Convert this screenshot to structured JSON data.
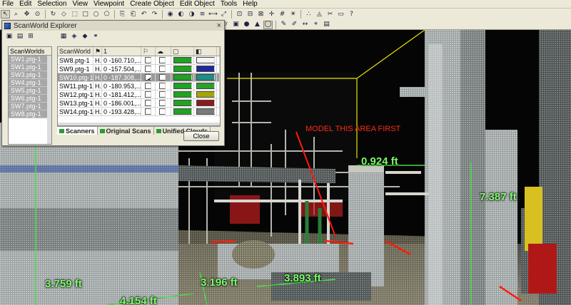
{
  "menu": [
    "File",
    "Edit",
    "Selection",
    "View",
    "Viewpoint",
    "Create Object",
    "Edit Object",
    "Tools",
    "Help"
  ],
  "toolbar": {
    "row1_icons": [
      "select-icon",
      "zoom-icon",
      "pan-icon",
      "seek-icon",
      "rotate-icon",
      "pick-icon",
      "fence-icon",
      "rectangle-icon",
      "ellipse-icon",
      "polygon-icon",
      "copy-icon",
      "paste-icon",
      "undo-icon",
      "redo-icon",
      "camera-icon",
      "visible-icon",
      "hide-icon",
      "layer-icon",
      "measure-icon",
      "fit-icon",
      "zoom-extents-icon",
      "ortho-icon",
      "perspective-icon",
      "snap-icon",
      "grid-icon",
      "lighting-icon",
      "pointcloud-icon",
      "mesh-icon",
      "clip-icon",
      "limit-box-icon",
      "help-icon"
    ],
    "row2_icons": [
      "color-map-icon",
      "intensity-icon",
      "true-color-icon",
      "gray-icon",
      "distance-icon",
      "axis-icon",
      "pipe-icon",
      "elbow-icon",
      "tee-icon",
      "flange-icon",
      "valve-icon",
      "steel-icon",
      "plane-icon",
      "patch-icon",
      "cylinder-icon",
      "box-icon",
      "sphere-icon",
      "cone-icon",
      "torus-icon",
      "annotate-icon",
      "label-icon",
      "dimension-icon",
      "coordinate-icon",
      "sheet-icon"
    ],
    "swatch_colors": [
      "#1a8a2e",
      "#2ea043",
      "#4ac25a",
      "#6bd97a",
      "#1d6f28",
      "#0f4d1b"
    ]
  },
  "viewport": {
    "annotation": "MODEL THIS AREA FIRST",
    "measurements": {
      "m1": "0.924 ft",
      "m2": "7.387 ft",
      "m3": "3.759 ft",
      "m4": "3.196 ft",
      "m5": "3.893 ft",
      "m6": "4.154 ft"
    },
    "colors": {
      "measure": "#7CFC6A",
      "annotation": "#ff2a1a",
      "limit_box": "#e6e600"
    }
  },
  "dialog": {
    "title": "ScanWorld Explorer",
    "close_glyph": "×",
    "left_header": "ScanWorlds",
    "scanworlds": [
      "SW1.ptg-1",
      "SW1.ptg-1",
      "SW3.ptg-1",
      "SW4.ptg-1",
      "SW5.ptg-1",
      "SW6.ptg-1",
      "SW7.ptg-1",
      "SW8.ptg-1"
    ],
    "grid_headers": [
      "ScanWorld",
      "",
      "1",
      "",
      "",
      "",
      "",
      "",
      ""
    ],
    "rows": [
      {
        "name": "SW8.ptg-1",
        "h": "H...",
        "num": "0  -160.710,...",
        "check1": "",
        "check2": "",
        "color1": "#1fa321",
        "color2": "#f4f4f4",
        "selected": false
      },
      {
        "name": "SW9.ptg-1",
        "h": "H...",
        "num": "0  -157.504,...",
        "check1": "",
        "check2": "",
        "color1": "#1fa321",
        "color2": "#1d2a99",
        "selected": false
      },
      {
        "name": "SW10.ptg-1",
        "h": "H...",
        "num": "0  -187.308,...",
        "check1": "✔",
        "check2": "",
        "color1": "#1fa321",
        "color2": "#1a8f8a",
        "selected": true
      },
      {
        "name": "SW11.ptg-1",
        "h": "H...",
        "num": "0  -180.953,...",
        "check1": "",
        "check2": "",
        "color1": "#1fa321",
        "color2": "#2aa02a",
        "selected": false
      },
      {
        "name": "SW12.ptg-1",
        "h": "H...",
        "num": "0  -181.412,...",
        "check1": "",
        "check2": "",
        "color1": "#1fa321",
        "color2": "#a6a600",
        "selected": false
      },
      {
        "name": "SW13.ptg-1",
        "h": "H...",
        "num": "0  -186.001,...",
        "check1": "",
        "check2": "",
        "color1": "#1fa321",
        "color2": "#8b1a1a",
        "selected": false
      },
      {
        "name": "SW14.ptg-1",
        "h": "H...",
        "num": "0  -193.428,...",
        "check1": "",
        "check2": "",
        "color1": "#1fa321",
        "color2": "#7a7a7a",
        "selected": false
      }
    ],
    "tabs": [
      "Scanners",
      "Original Scans",
      "Unified Clouds"
    ],
    "close_button": "Close"
  }
}
